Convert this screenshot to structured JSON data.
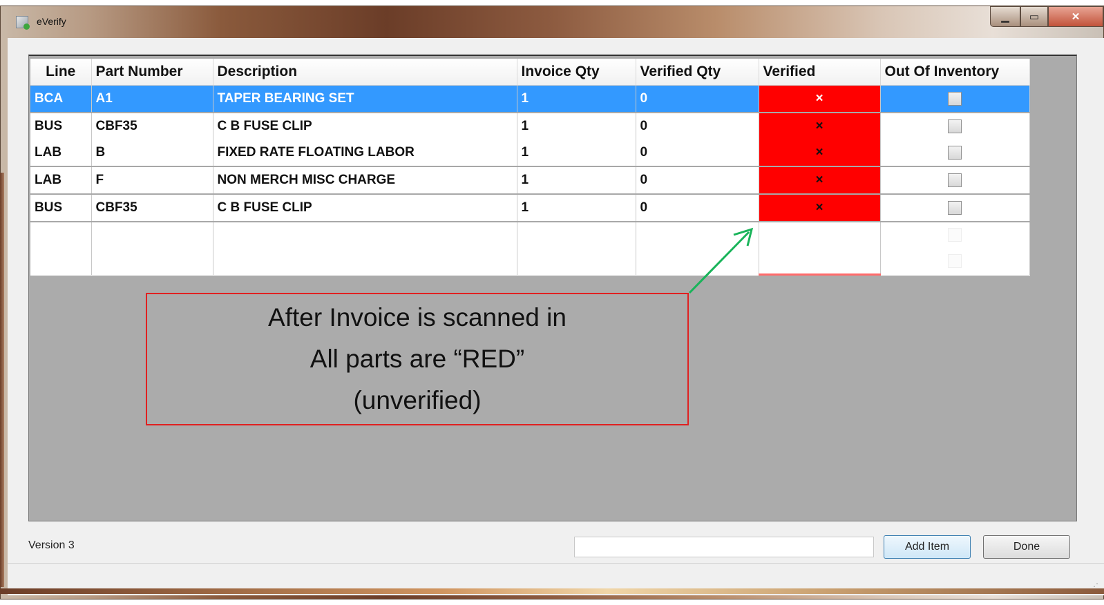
{
  "window": {
    "title": "eVerify"
  },
  "grid": {
    "columns": [
      "Line",
      "Part Number",
      "Description",
      "Invoice Qty",
      "Verified Qty",
      "Verified",
      "Out Of Inventory"
    ],
    "rows": [
      {
        "line": "BCA",
        "part_number": "A1",
        "description": "TAPER BEARING SET",
        "invoice_qty": "1",
        "verified_qty": "0",
        "verified": "×"
      },
      {
        "line": "BUS",
        "part_number": "CBF35",
        "description": "C B FUSE CLIP",
        "invoice_qty": "1",
        "verified_qty": "0",
        "verified": "×"
      },
      {
        "line": "LAB",
        "part_number": "B",
        "description": "FIXED RATE FLOATING LABOR",
        "invoice_qty": "1",
        "verified_qty": "0",
        "verified": "×"
      },
      {
        "line": "LAB",
        "part_number": "F",
        "description": "NON MERCH MISC CHARGE",
        "invoice_qty": "1",
        "verified_qty": "0",
        "verified": "×"
      },
      {
        "line": "BUS",
        "part_number": "CBF35",
        "description": "C B FUSE CLIP",
        "invoice_qty": "1",
        "verified_qty": "0",
        "verified": "×"
      }
    ]
  },
  "status": {
    "version": "Version 3"
  },
  "buttons": {
    "add_item": "Add Item",
    "done": "Done"
  },
  "callout": {
    "lines": [
      "After Invoice is scanned in",
      "All parts are “RED”",
      "(unverified)"
    ]
  },
  "colors": {
    "unverified": "#ff0000",
    "selection": "#3399ff",
    "arrow": "#19b45a"
  }
}
